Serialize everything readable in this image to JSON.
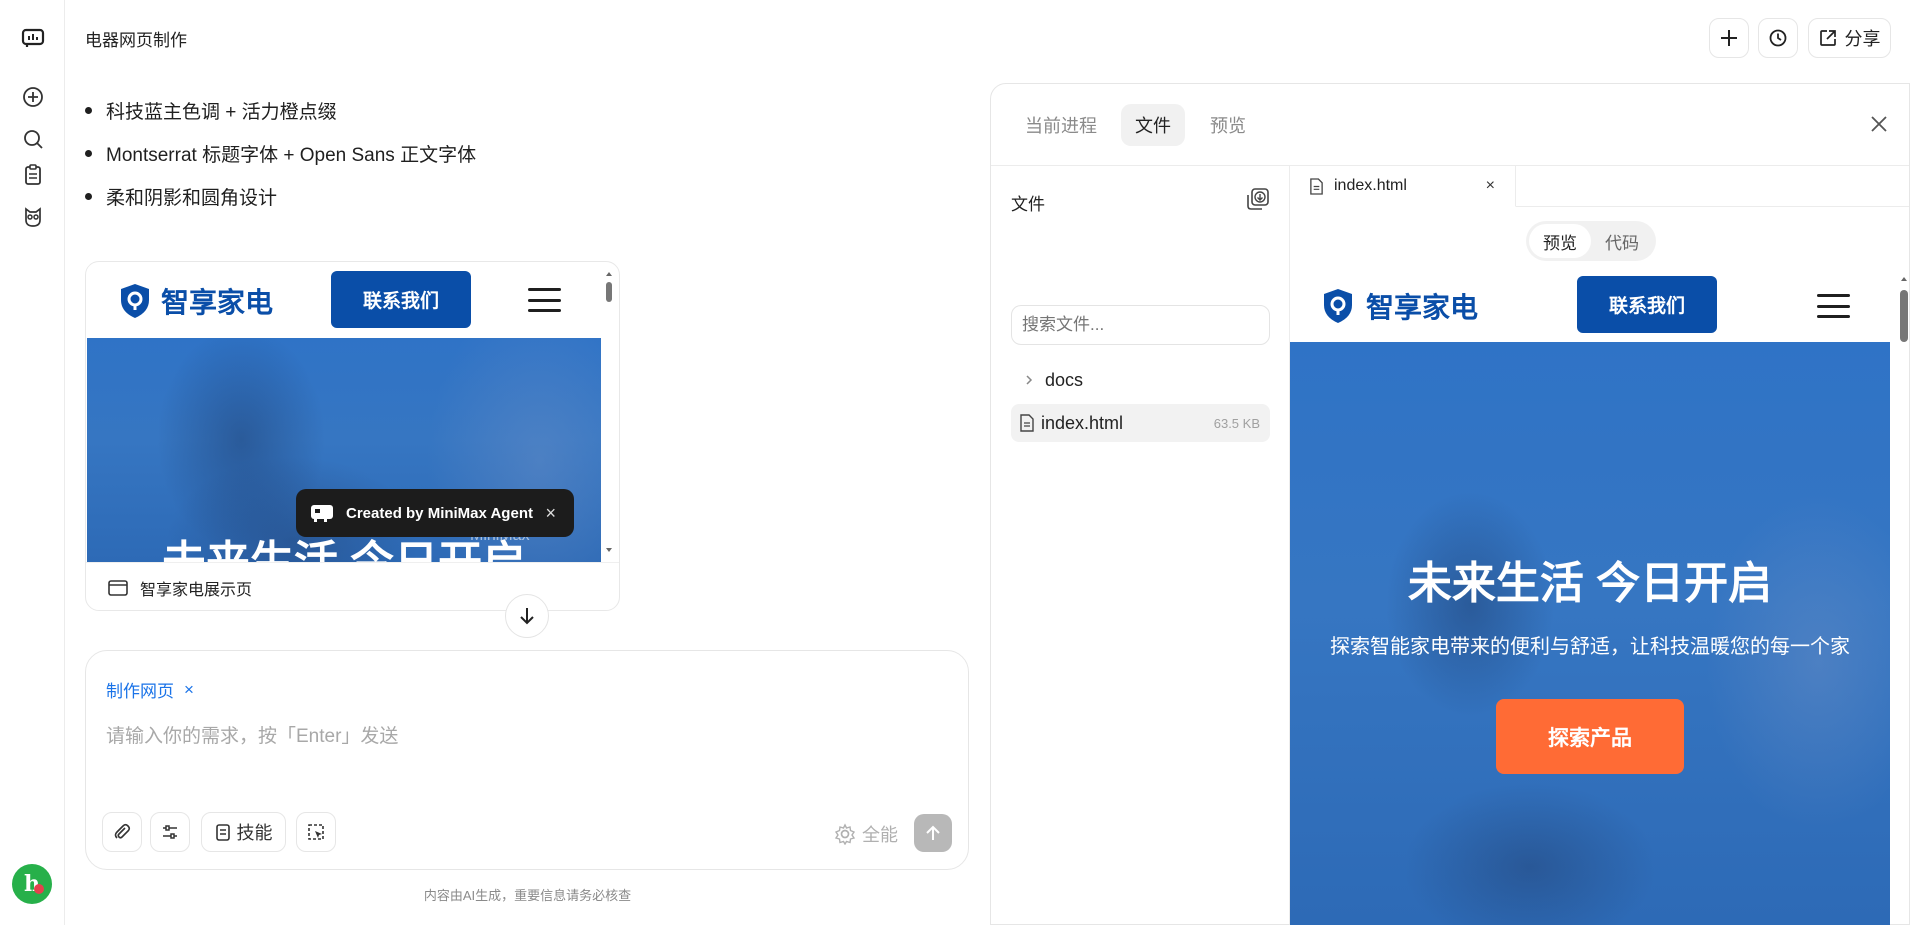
{
  "app": {
    "title": "电器网页制作",
    "share_label": "分享"
  },
  "sidebar": {
    "items": [
      {
        "icon": "logo-icon"
      },
      {
        "icon": "new-chat-icon"
      },
      {
        "icon": "search-icon"
      },
      {
        "icon": "clipboard-icon"
      },
      {
        "icon": "owl-icon"
      }
    ],
    "avatar_letter": "h"
  },
  "chat": {
    "bullets": [
      "科技蓝主色调 + 活力橙点缀",
      "Montserrat 标题字体 + Open Sans 正文字体",
      "柔和阴影和圆角设计"
    ],
    "card": {
      "footer_label": "智享家电展示页",
      "badge": "Created by MiniMax Agent",
      "badge_close": "×",
      "watermark": "MiniMax"
    },
    "composer": {
      "tag": "制作网页",
      "tag_close": "×",
      "placeholder": "请输入你的需求，按「Enter」发送",
      "skills_label": "技能",
      "mode_label": "全能"
    },
    "disclaimer": "内容由AI生成，重要信息请务必核查"
  },
  "site": {
    "brand": "智享家电",
    "contact_label": "联系我们",
    "hero_title": "未来生活 今日开启",
    "hero_subtitle": "探索智能家电带来的便利与舒适，让科技温暖您的每一个家",
    "explore_label": "探索产品",
    "colors": {
      "primary": "#0a4ea8",
      "accent": "#ff6b35"
    }
  },
  "panel": {
    "tabs": [
      "当前进程",
      "文件",
      "预览"
    ],
    "active_tab": "文件",
    "files_title": "文件",
    "search_placeholder": "搜索文件...",
    "tree": [
      {
        "name": "docs",
        "type": "folder"
      },
      {
        "name": "index.html",
        "type": "file",
        "size": "63.5 KB"
      }
    ],
    "open_file": "index.html",
    "open_file_close": "×",
    "view_modes": [
      "预览",
      "代码"
    ]
  }
}
